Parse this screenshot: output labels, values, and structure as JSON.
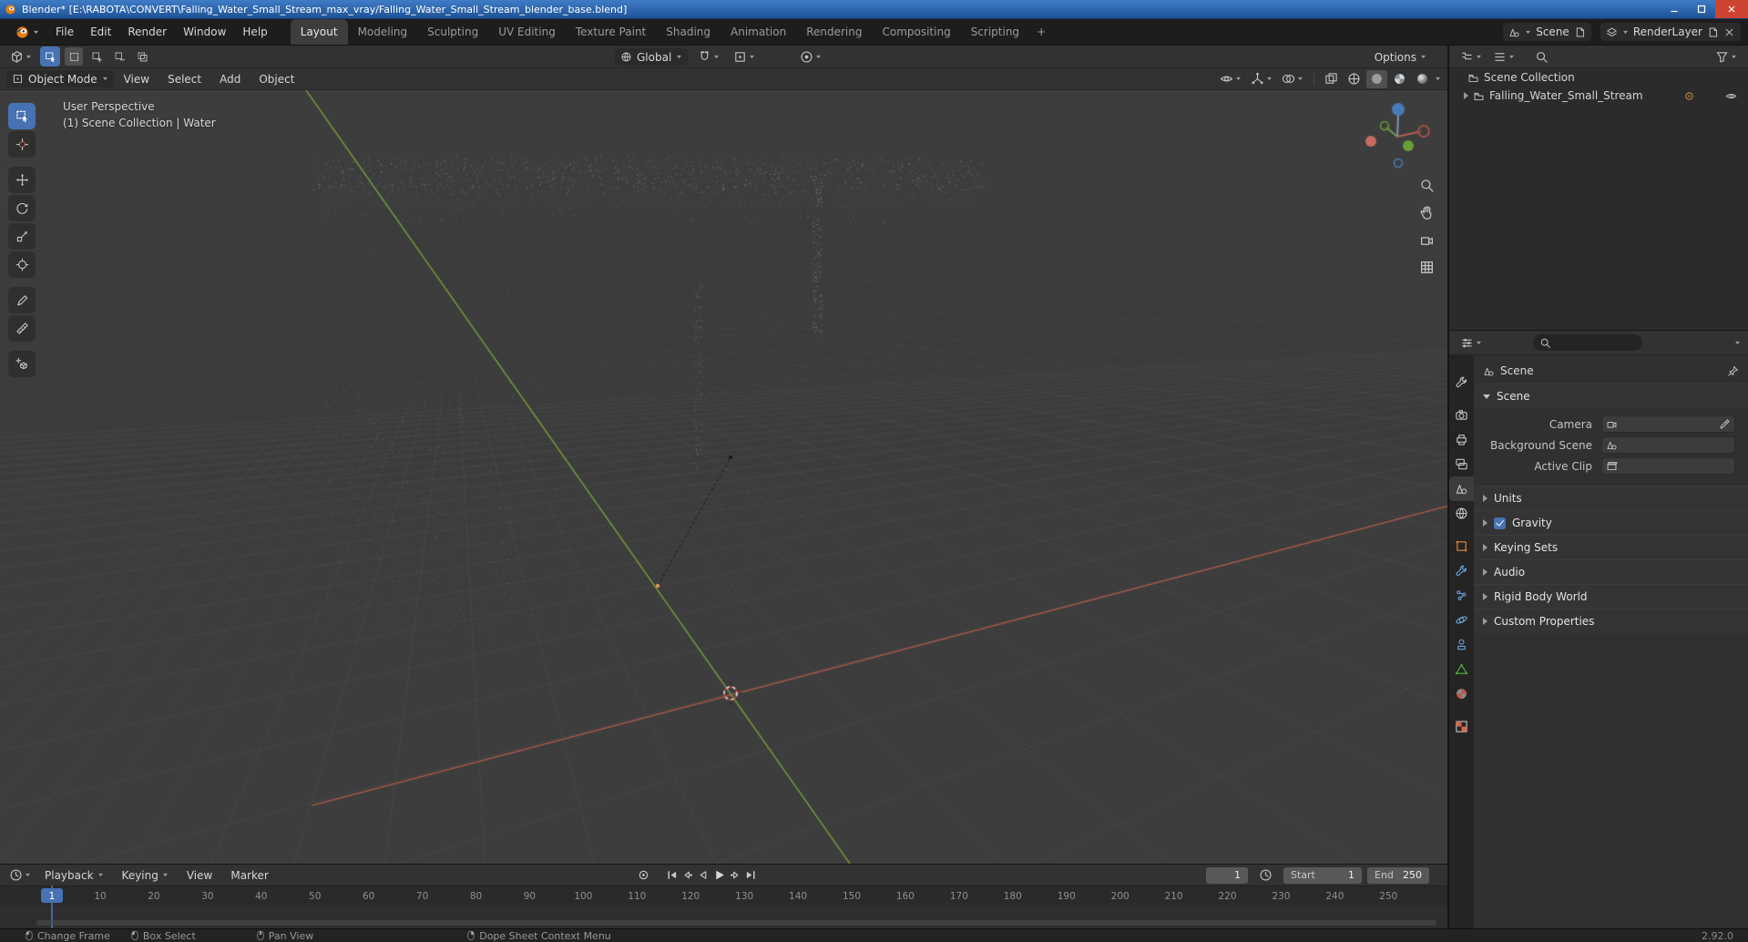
{
  "titlebar": {
    "title": "Blender* [E:\\RABOTA\\CONVERT\\Falling_Water_Small_Stream_max_vray/Falling_Water_Small_Stream_blender_base.blend]"
  },
  "topbar": {
    "menus": [
      "File",
      "Edit",
      "Render",
      "Window",
      "Help"
    ],
    "workspaces": [
      "Layout",
      "Modeling",
      "Sculpting",
      "UV Editing",
      "Texture Paint",
      "Shading",
      "Animation",
      "Rendering",
      "Compositing",
      "Scripting"
    ],
    "add_tab": "+",
    "scene": "Scene",
    "view_layer": "RenderLayer"
  },
  "tool_settings": {
    "orientation": "Global",
    "options": "Options"
  },
  "view_header": {
    "mode": "Object Mode",
    "menus": [
      "View",
      "Select",
      "Add",
      "Object"
    ]
  },
  "viewport": {
    "overlay_title": "User Perspective",
    "overlay_subtitle": "(1) Scene Collection | Water"
  },
  "outliner": {
    "root": "Scene Collection",
    "collection": "Falling_Water_Small_Stream"
  },
  "properties": {
    "breadcrumb": "Scene",
    "scene_panel": {
      "title": "Scene",
      "fields": [
        {
          "label": "Camera"
        },
        {
          "label": "Background Scene"
        },
        {
          "label": "Active Clip"
        }
      ]
    },
    "collapsed": [
      "Units",
      "Gravity",
      "Keying Sets",
      "Audio",
      "Rigid Body World",
      "Custom Properties"
    ]
  },
  "timeline": {
    "menus": [
      "Playback",
      "Keying",
      "View",
      "Marker"
    ],
    "current_frame": "1",
    "start_label": "Start",
    "start_value": "1",
    "end_label": "End",
    "end_value": "250",
    "playhead": "1",
    "ticks": [
      "10",
      "20",
      "30",
      "40",
      "50",
      "60",
      "70",
      "80",
      "90",
      "100",
      "110",
      "120",
      "130",
      "140",
      "150",
      "160",
      "170",
      "180",
      "190",
      "200",
      "210",
      "220",
      "230",
      "240",
      "250"
    ]
  },
  "statusbar": {
    "hints": [
      "Change Frame",
      "Box Select",
      "Pan View",
      "Dope Sheet Context Menu"
    ],
    "version": "2.92.0"
  },
  "colors": {
    "accent": "#4772b3",
    "axis_x": "#aa564a",
    "axis_y": "#789e3e",
    "object_orange": "#e8883a",
    "modifier_blue": "#6aa3d8",
    "data_green": "#54b33e"
  }
}
